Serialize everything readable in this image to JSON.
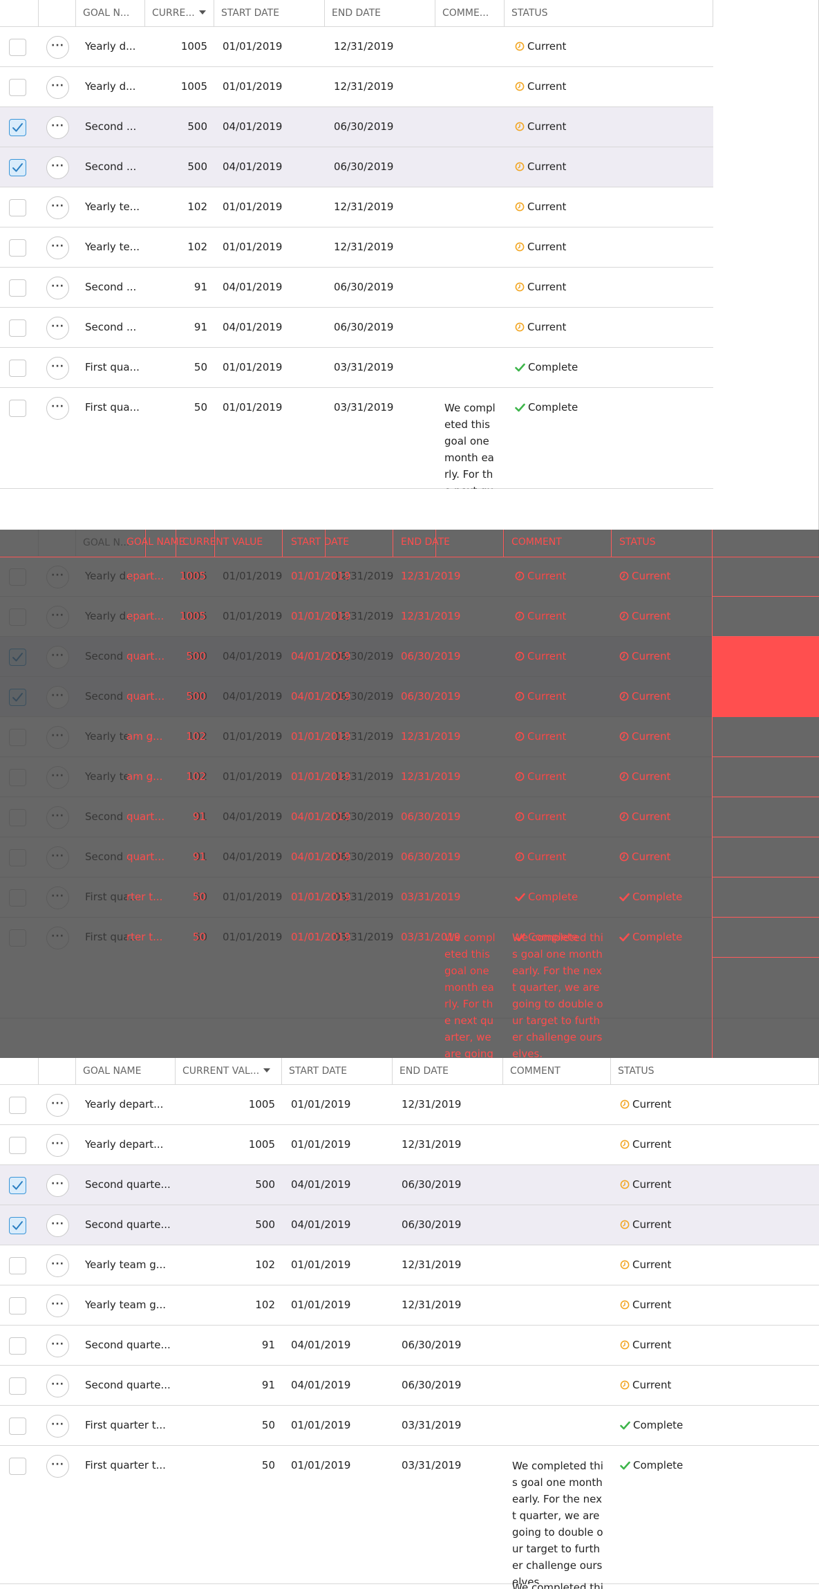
{
  "columns": {
    "goal_name": "GOAL NAME",
    "current_value": "CURRENT VALUE",
    "start_date": "START DATE",
    "end_date": "END DATE",
    "comment": "COMMENT",
    "status": "STATUS"
  },
  "truncated_headers": {
    "goal_name": "GOAL N...",
    "current_value": "CURRE...",
    "current_value_mid": "CURRENT VAL...",
    "comment": "COMME..."
  },
  "rows": [
    {
      "goal_short": "Yearly d...",
      "goal_mid": "Yearly depart...",
      "value": "1005",
      "start": "01/01/2019",
      "end": "12/31/2019",
      "status": "Current",
      "checked": false,
      "comment": ""
    },
    {
      "goal_short": "Yearly d...",
      "goal_mid": "Yearly depart...",
      "value": "1005",
      "start": "01/01/2019",
      "end": "12/31/2019",
      "status": "Current",
      "checked": false,
      "comment": ""
    },
    {
      "goal_short": "Second ...",
      "goal_mid": "Second quarte...",
      "value": "500",
      "start": "04/01/2019",
      "end": "06/30/2019",
      "status": "Current",
      "checked": true,
      "comment": ""
    },
    {
      "goal_short": "Second ...",
      "goal_mid": "Second quarte...",
      "value": "500",
      "start": "04/01/2019",
      "end": "06/30/2019",
      "status": "Current",
      "checked": true,
      "comment": ""
    },
    {
      "goal_short": "Yearly te...",
      "goal_mid": "Yearly team g...",
      "value": "102",
      "start": "01/01/2019",
      "end": "12/31/2019",
      "status": "Current",
      "checked": false,
      "comment": ""
    },
    {
      "goal_short": "Yearly te...",
      "goal_mid": "Yearly team g...",
      "value": "102",
      "start": "01/01/2019",
      "end": "12/31/2019",
      "status": "Current",
      "checked": false,
      "comment": ""
    },
    {
      "goal_short": "Second ...",
      "goal_mid": "Second quarte...",
      "value": "91",
      "start": "04/01/2019",
      "end": "06/30/2019",
      "status": "Current",
      "checked": false,
      "comment": ""
    },
    {
      "goal_short": "Second ...",
      "goal_mid": "Second quarte...",
      "value": "91",
      "start": "04/01/2019",
      "end": "06/30/2019",
      "status": "Current",
      "checked": false,
      "comment": ""
    },
    {
      "goal_short": "First qua...",
      "goal_mid": "First quarter t...",
      "value": "50",
      "start": "01/01/2019",
      "end": "03/31/2019",
      "status": "Complete",
      "checked": false,
      "comment": ""
    },
    {
      "goal_short": "First qua...",
      "goal_mid": "First quarter t...",
      "value": "50",
      "start": "01/01/2019",
      "end": "03/31/2019",
      "status": "Complete",
      "checked": false,
      "comment": "We completed this goal one month early. For the next quarter, we are going to double our target to further challenge ourselves."
    }
  ],
  "overlay_goal_fragments": [
    "epart...",
    "epart...",
    "quarte...",
    "quarte...",
    "am g...",
    "am g...",
    "quarte...",
    "quarte...",
    "rter t...",
    "rter t..."
  ],
  "extra_comment_fragment": "We completed thi",
  "more_label": "···",
  "colors": {
    "current": "#f2a623",
    "complete": "#3db54a",
    "selected_row": "#eeecf3",
    "checkbox_checked": "#3a95d8",
    "overlay_red": "#ff4d4d"
  }
}
